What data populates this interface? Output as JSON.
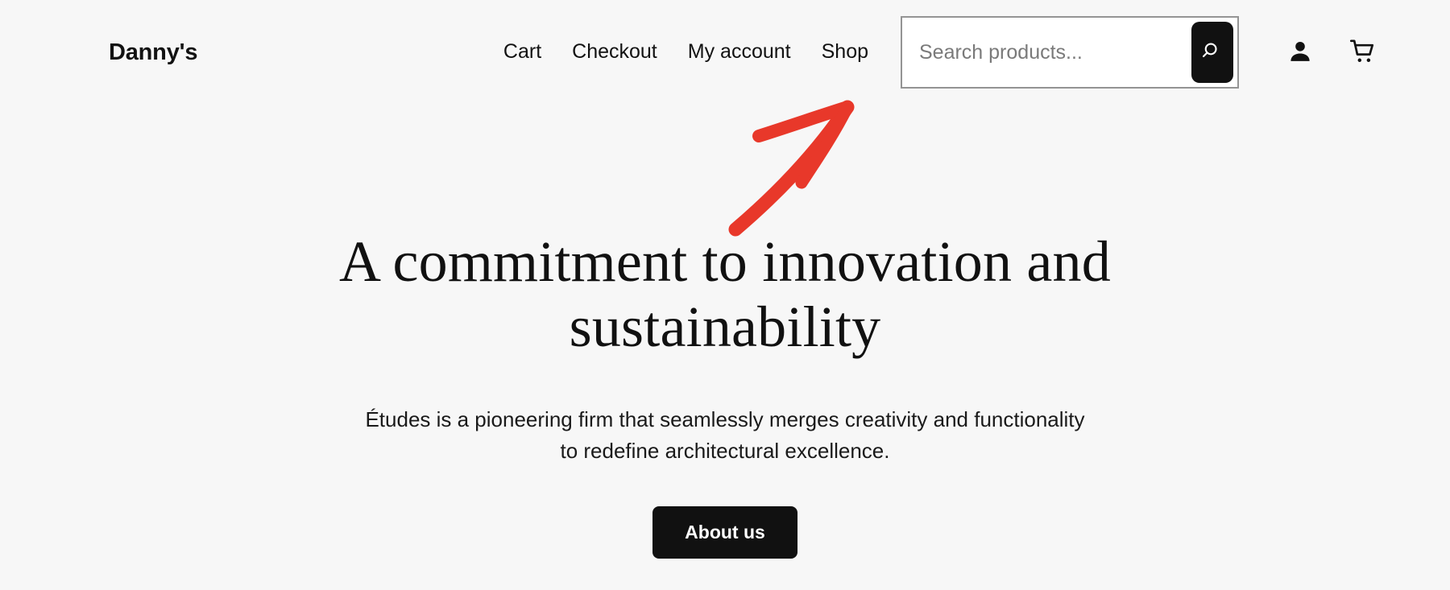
{
  "site": {
    "title": "Danny's",
    "background_color": "#f7f7f7",
    "accent_color": "#111111"
  },
  "header": {
    "nav": [
      {
        "label": "Cart",
        "name": "nav-item-cart"
      },
      {
        "label": "Checkout",
        "name": "nav-item-checkout"
      },
      {
        "label": "My account",
        "name": "nav-item-my-account"
      },
      {
        "label": "Shop",
        "name": "nav-item-shop"
      }
    ],
    "search": {
      "placeholder": "Search products...",
      "value": "",
      "button_icon": "search-icon",
      "border_color": "#949494",
      "button_color": "#111111"
    },
    "icons": [
      {
        "name": "account-icon",
        "label": "Account"
      },
      {
        "name": "cart-icon",
        "label": "Cart"
      }
    ]
  },
  "hero": {
    "title": "A commitment to innovation and sustainability",
    "paragraph": "Études is a pioneering firm that seamlessly merges creativity and functionality to redefine architectural excellence.",
    "cta_label": "About us"
  },
  "annotation": {
    "type": "hand-drawn-arrow",
    "color": "#e8382a",
    "points_to": "search-products-field",
    "direction": "up-right"
  }
}
